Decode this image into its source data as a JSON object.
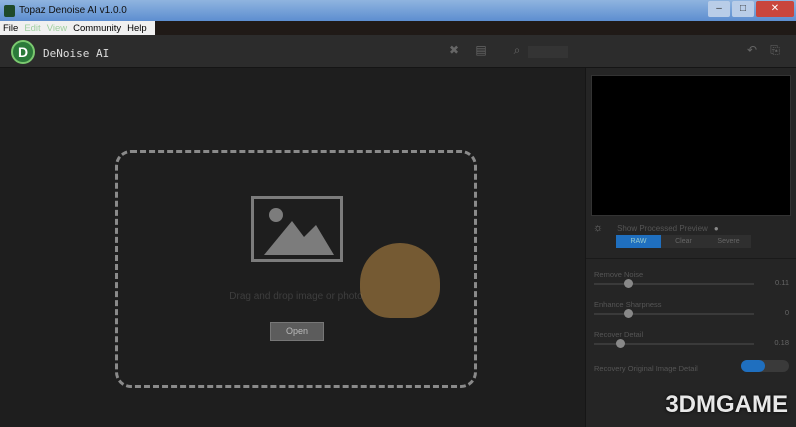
{
  "window": {
    "title": "Topaz Denoise AI v1.0.0",
    "min": "–",
    "max": "□",
    "close": "✕"
  },
  "menu": [
    {
      "label": "File",
      "enabled": true
    },
    {
      "label": "Edit",
      "enabled": false
    },
    {
      "label": "View",
      "enabled": false
    },
    {
      "label": "Community",
      "enabled": true
    },
    {
      "label": "Help",
      "enabled": true
    }
  ],
  "toolbar": {
    "logo": "D",
    "app_name": "DeNoise AI"
  },
  "canvas": {
    "drop_text": "Drag and drop image or photo",
    "open_label": "Open"
  },
  "panel": {
    "preview_label": "Show Processed Preview",
    "tabs": [
      "RAW",
      "Clear",
      "Severe"
    ],
    "active_tab": "RAW",
    "sliders": [
      {
        "label": "Remove Noise",
        "value": "0.11",
        "fraction": 0.2
      },
      {
        "label": "Enhance Sharpness",
        "value": "0",
        "fraction": 0.2
      },
      {
        "label": "Recover Detail",
        "value": "0.18",
        "fraction": 0.15
      }
    ],
    "toggle_label": "Recovery Original Image Detail",
    "toggle_on": true
  },
  "watermark": "3DMGAME",
  "accent": "#1f6fbf"
}
